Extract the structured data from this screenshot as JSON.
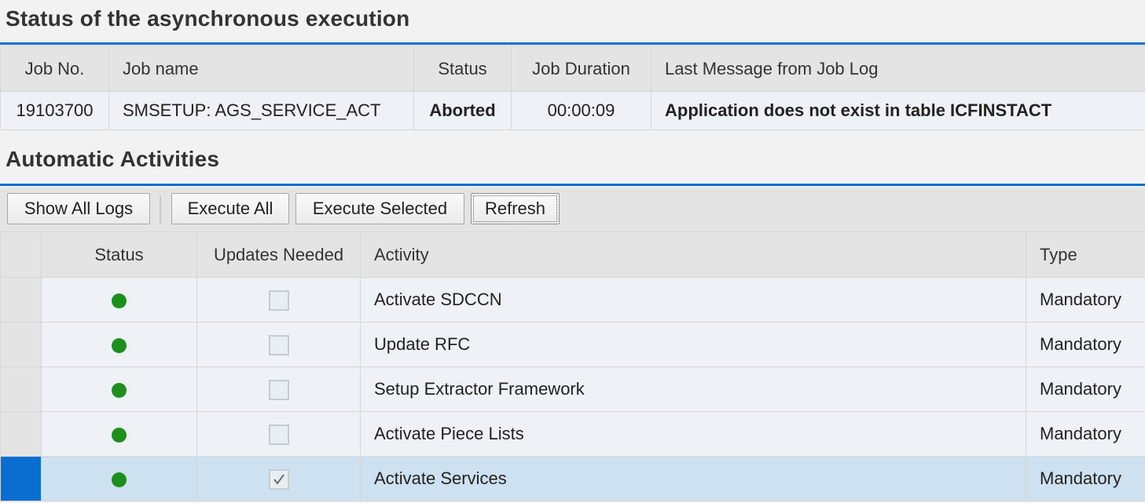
{
  "status_section": {
    "title": "Status of the asynchronous execution",
    "columns": [
      "Job No.",
      "Job name",
      "Status",
      "Job Duration",
      "Last Message from Job Log"
    ],
    "row": {
      "job_no": "19103700",
      "job_name": "SMSETUP: AGS_SERVICE_ACT",
      "status": "Aborted",
      "duration": "00:00:09",
      "message": "Application does not exist in table ICFINSTACT"
    }
  },
  "activities_section": {
    "title": "Automatic Activities",
    "toolbar": {
      "show_all_logs": "Show All Logs",
      "execute_all": "Execute All",
      "execute_selected": "Execute Selected",
      "refresh": "Refresh"
    },
    "columns": {
      "status": "Status",
      "updates_needed": "Updates Needed",
      "activity": "Activity",
      "type": "Type"
    },
    "rows": [
      {
        "status_icon": "green-status-icon",
        "updates_needed": false,
        "activity": "Activate SDCCN",
        "type": "Mandatory",
        "selected": false
      },
      {
        "status_icon": "green-status-icon",
        "updates_needed": false,
        "activity": "Update RFC",
        "type": "Mandatory",
        "selected": false
      },
      {
        "status_icon": "green-status-icon",
        "updates_needed": false,
        "activity": "Setup Extractor Framework",
        "type": "Mandatory",
        "selected": false
      },
      {
        "status_icon": "green-status-icon",
        "updates_needed": false,
        "activity": "Activate Piece Lists",
        "type": "Mandatory",
        "selected": false
      },
      {
        "status_icon": "green-status-icon",
        "updates_needed": true,
        "activity": "Activate Services",
        "type": "Mandatory",
        "selected": true
      }
    ]
  },
  "colors": {
    "accent": "#0a6ed1",
    "status_ok": "#1d8f1d",
    "selected_row": "#cde1f0"
  }
}
